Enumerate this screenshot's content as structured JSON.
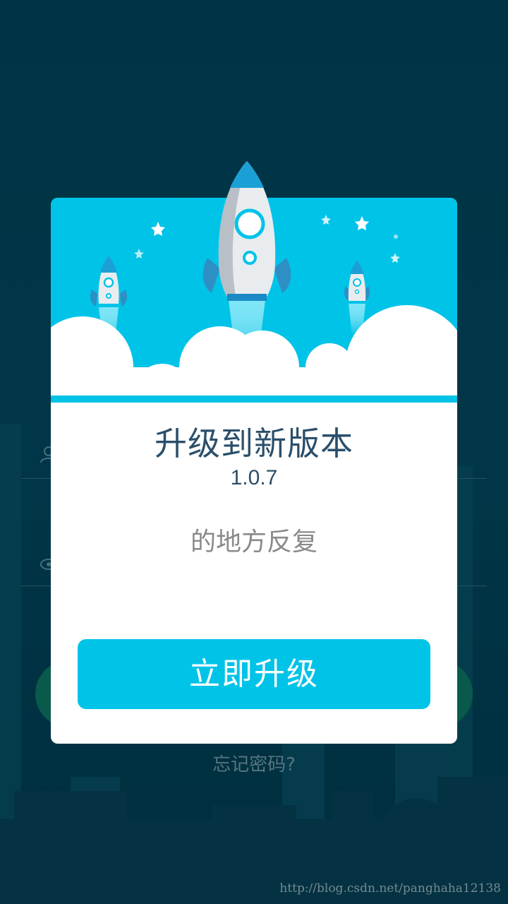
{
  "dialog": {
    "title": "升级到新版本",
    "version": "1.0.7",
    "description": "的地方反复",
    "button_label": "立即升级"
  },
  "login": {
    "forgot_password": "忘记密码?",
    "username_icon": "user-icon",
    "password_icon": "eye-icon"
  },
  "watermark": "http://blog.csdn.net/panghaha12138",
  "colors": {
    "background": "#003a4d",
    "banner": "#00c3e8",
    "button": "#00c3e8",
    "title": "#2b4f6a",
    "description": "#8a8a8a"
  }
}
